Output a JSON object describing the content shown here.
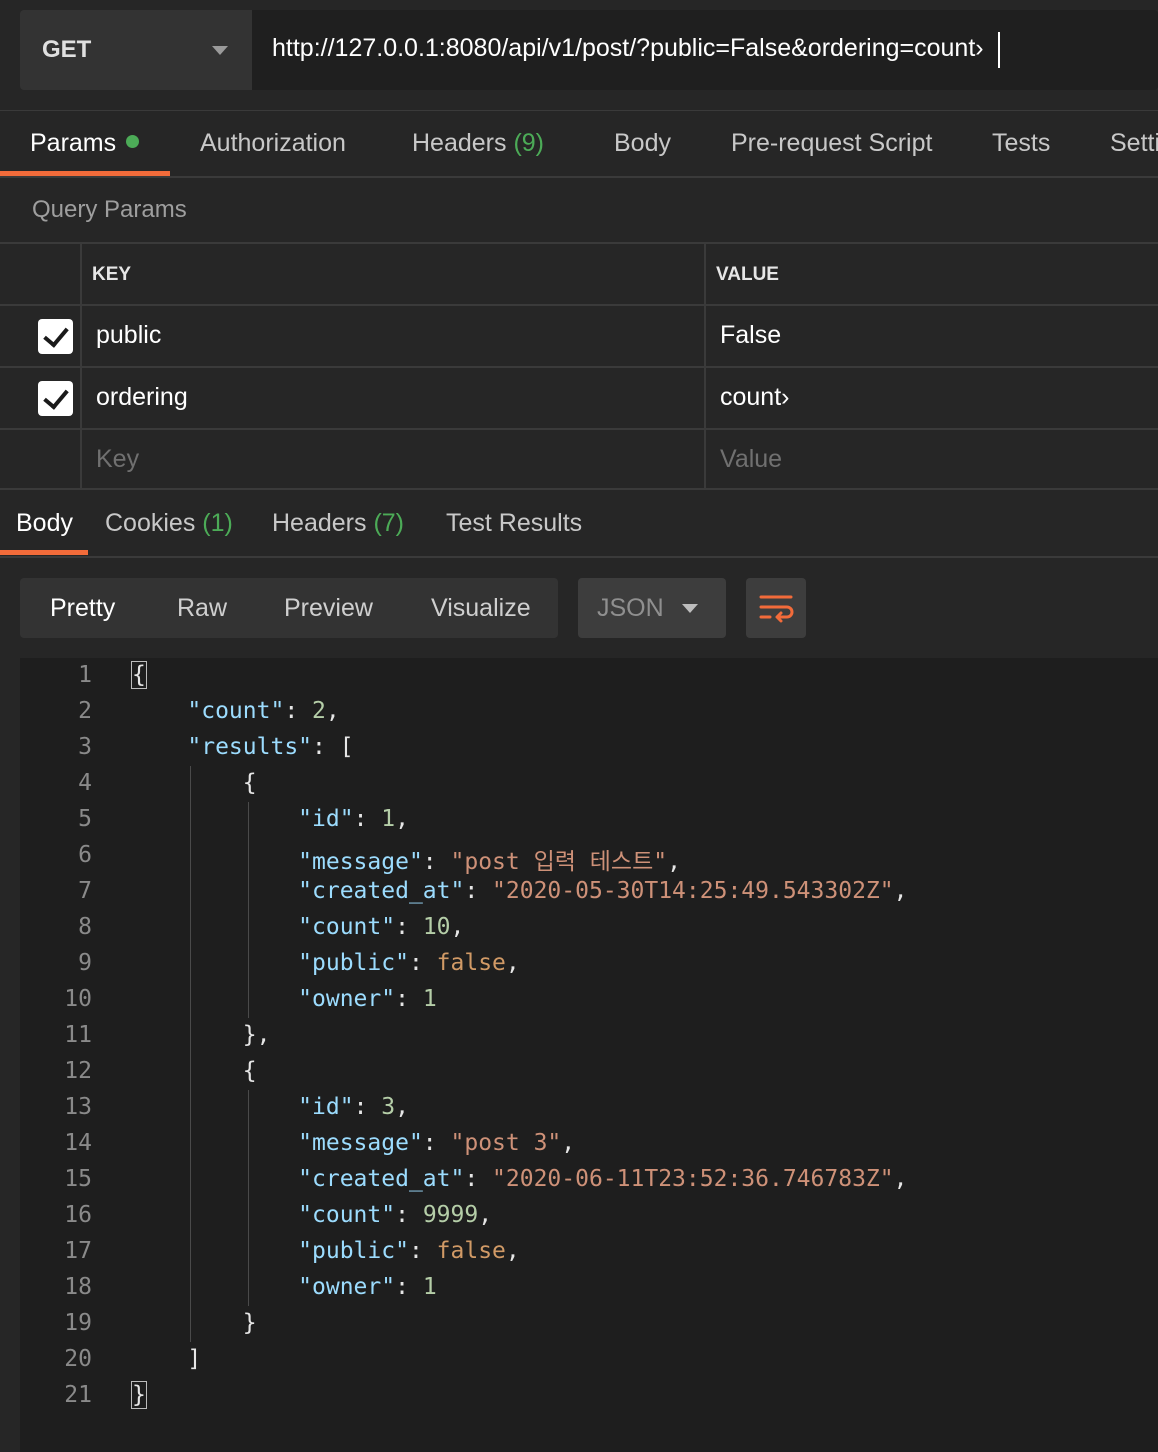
{
  "request": {
    "method": "GET",
    "url": "http://127.0.0.1:8080/api/v1/post/?public=False&ordering=count›"
  },
  "request_tabs": [
    {
      "label": "Params",
      "count": "",
      "active": true,
      "dot": true
    },
    {
      "label": "Authorization",
      "count": ""
    },
    {
      "label": "Headers",
      "count": "(9)"
    },
    {
      "label": "Body",
      "count": ""
    },
    {
      "label": "Pre-request Script",
      "count": ""
    },
    {
      "label": "Tests",
      "count": ""
    },
    {
      "label": "Setti",
      "count": ""
    }
  ],
  "query_params": {
    "title": "Query Params",
    "key_header": "KEY",
    "value_header": "VALUE",
    "rows": [
      {
        "key": "public",
        "value": "False",
        "checked": true
      },
      {
        "key": "ordering",
        "value": "count›",
        "checked": true
      }
    ],
    "key_placeholder": "Key",
    "value_placeholder": "Value"
  },
  "response_tabs": [
    {
      "label": "Body",
      "count": "",
      "active": true
    },
    {
      "label": "Cookies",
      "count": "(1)"
    },
    {
      "label": "Headers",
      "count": "(7)"
    },
    {
      "label": "Test Results",
      "count": ""
    }
  ],
  "view_modes": [
    "Pretty",
    "Raw",
    "Preview",
    "Visualize"
  ],
  "active_view_mode": "Pretty",
  "format": "JSON",
  "wrap_icon": "wrap-lines-icon",
  "colors": {
    "accent": "#f26b3a",
    "success": "#4cab57"
  },
  "code_lines": [
    "{",
    "    \"count\": 2,",
    "    \"results\": [",
    "        {",
    "            \"id\": 1,",
    "            \"message\": \"post 입력 테스트\",",
    "            \"created_at\": \"2020-05-30T14:25:49.543302Z\",",
    "            \"count\": 10,",
    "            \"public\": false,",
    "            \"owner\": 1",
    "        },",
    "        {",
    "            \"id\": 3,",
    "            \"message\": \"post 3\",",
    "            \"created_at\": \"2020-06-11T23:52:36.746783Z\",",
    "            \"count\": 9999,",
    "            \"public\": false,",
    "            \"owner\": 1",
    "        }",
    "    ]",
    "}"
  ]
}
